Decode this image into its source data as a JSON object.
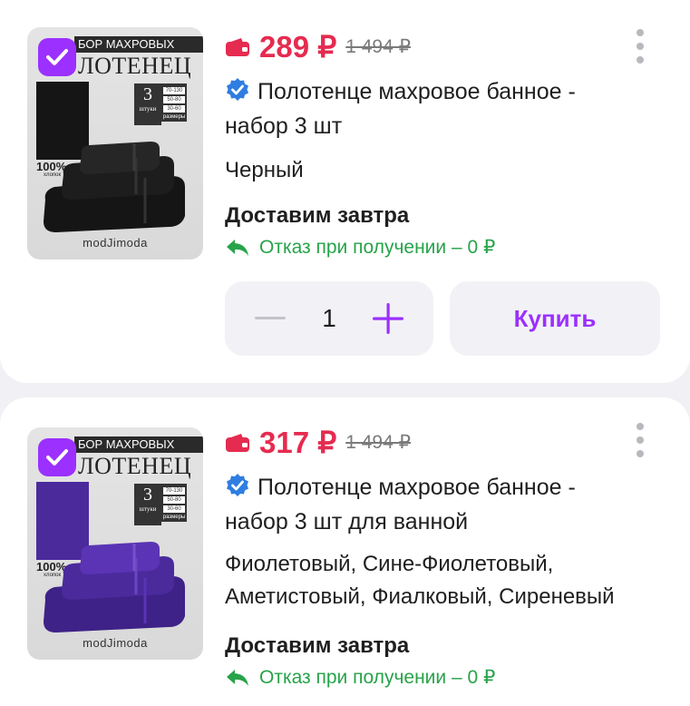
{
  "products": [
    {
      "thumb": {
        "banner_top": "БОР МАХРОВЫХ",
        "banner_big": "ЛОТЕНЕЦ",
        "qty_num": "3",
        "qty_word": "штуки",
        "sizes": [
          "70-130",
          "50-80",
          "30-60"
        ],
        "sizes_caption": "размеры",
        "pct": "100%",
        "pct_sub": "хлопок",
        "brand": "modJimoda",
        "towel_color": "#151515"
      },
      "price": "289 ₽",
      "old_price": "1 494 ₽",
      "title": "Полотенце махровое банное - набор 3 шт",
      "variant": "Черный",
      "delivery": "Доставим завтра",
      "refund": "Отказ при получении – 0 ₽",
      "quantity": "1",
      "buy_label": "Купить"
    },
    {
      "thumb": {
        "banner_top": "БОР МАХРОВЫХ",
        "banner_big": "ЛОТЕНЕЦ",
        "qty_num": "3",
        "qty_word": "штуки",
        "sizes": [
          "70-130",
          "50-80",
          "30-60"
        ],
        "sizes_caption": "размеры",
        "pct": "100%",
        "pct_sub": "хлопок",
        "brand": "modJimoda",
        "towel_color": "#4b2a9c"
      },
      "price": "317 ₽",
      "old_price": "1 494 ₽",
      "title": "Полотенце махровое банное - набор 3 шт для ванной",
      "variant": "Фиолетовый, Сине-Фиолетовый, Аметистовый, Фиалковый, Сиреневый",
      "delivery": "Доставим завтра",
      "refund": "Отказ при получении – 0 ₽"
    }
  ],
  "colors": {
    "accent": "#9b30ff",
    "price": "#e52b50",
    "refund": "#27a34a",
    "verified": "#2f7de1"
  },
  "icons": {
    "wallet": "wallet-icon",
    "verified": "verified-check-icon",
    "refund": "return-arrow-icon",
    "menu": "kebab-menu-icon",
    "selected": "checkbox-checked-icon"
  }
}
